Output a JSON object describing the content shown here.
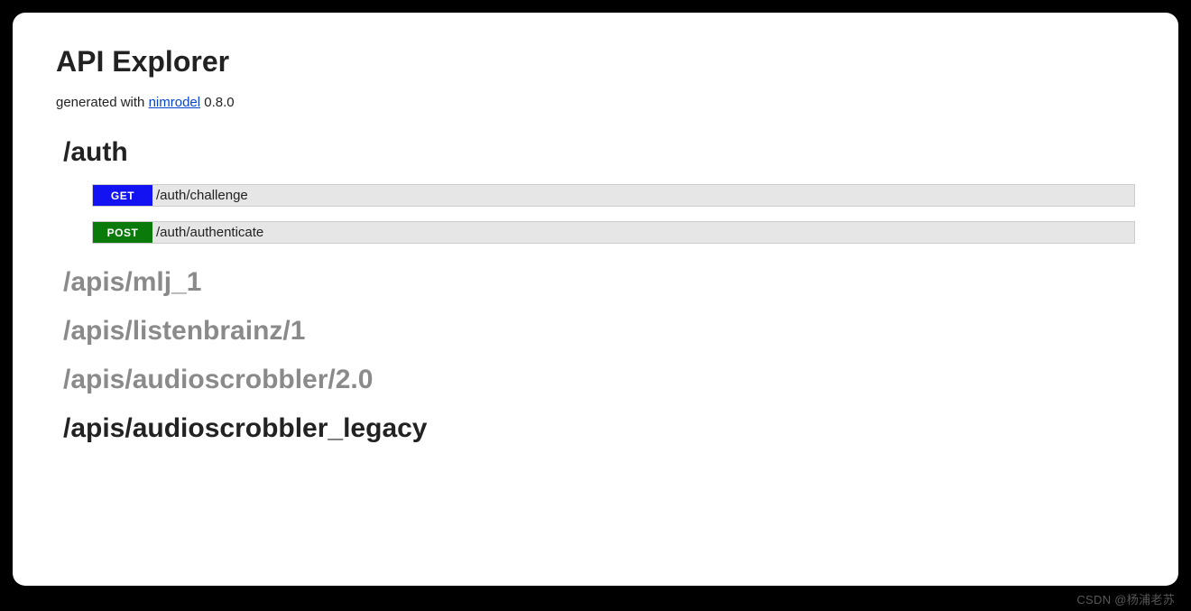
{
  "page": {
    "title": "API Explorer",
    "generated_prefix": "generated with ",
    "nimrodel_link_text": "nimrodel",
    "nimrodel_version_suffix": " 0.8.0"
  },
  "sections": {
    "auth": {
      "heading": "/auth",
      "endpoints": [
        {
          "method": "GET",
          "path": "/auth/challenge"
        },
        {
          "method": "POST",
          "path": "/auth/authenticate"
        }
      ]
    },
    "mlj_1": {
      "heading": "/apis/mlj_1"
    },
    "listenbrainz": {
      "heading": "/apis/listenbrainz/1"
    },
    "audioscrobbler": {
      "heading": "/apis/audioscrobbler/2.0"
    },
    "audioscrobbler_legacy": {
      "heading": "/apis/audioscrobbler_legacy"
    }
  },
  "watermark": "CSDN @杨浦老苏"
}
